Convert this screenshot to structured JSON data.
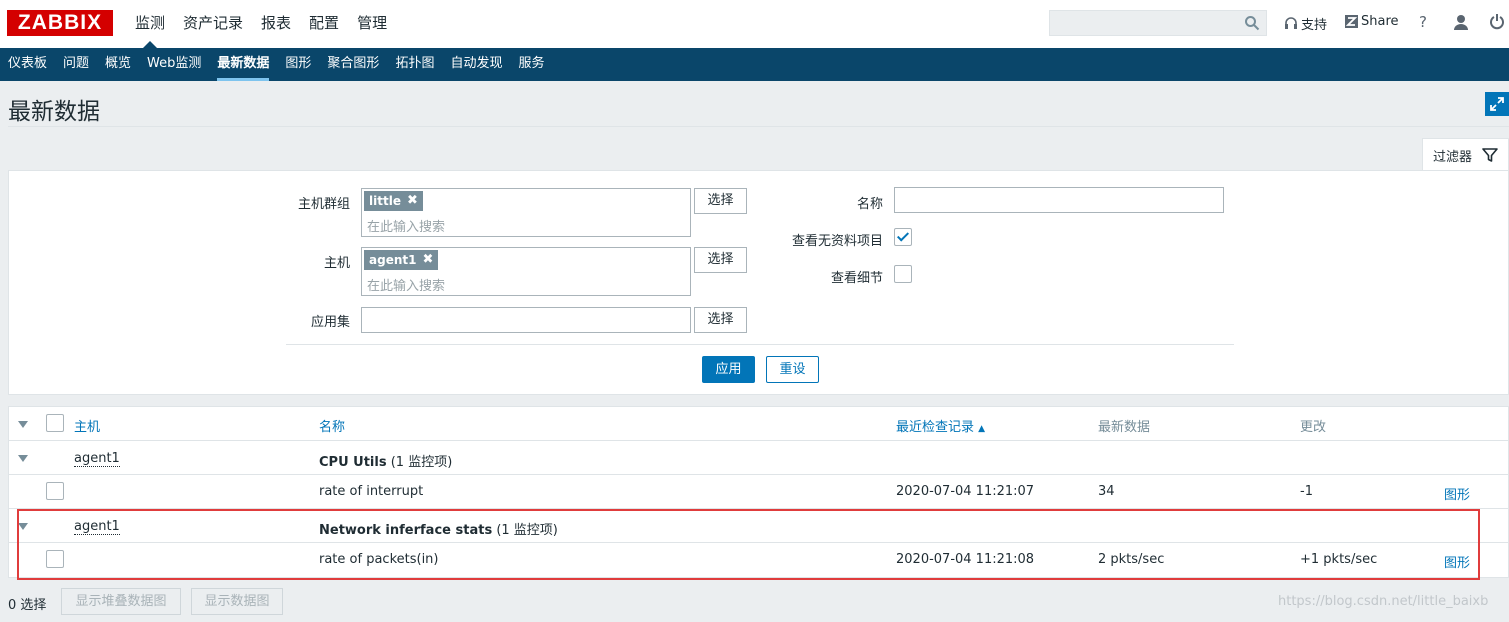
{
  "header": {
    "logo": "ZABBIX",
    "nav": [
      "监测",
      "资产记录",
      "报表",
      "配置",
      "管理"
    ],
    "support": "支持",
    "share": "Share",
    "help": "?"
  },
  "subnav": [
    "仪表板",
    "问题",
    "概览",
    "Web监测",
    "最新数据",
    "图形",
    "聚合图形",
    "拓扑图",
    "自动发现",
    "服务"
  ],
  "page_title": "最新数据",
  "filter": {
    "tab_label": "过滤器",
    "hostgroup_label": "主机群组",
    "hostgroup_chip": "little",
    "hostgroup_placeholder": "在此输入搜索",
    "host_label": "主机",
    "host_chip": "agent1",
    "host_placeholder": "在此输入搜索",
    "application_label": "应用集",
    "select_label": "选择",
    "name_label": "名称",
    "show_without_data_label": "查看无资料项目",
    "show_without_data_checked": true,
    "show_details_label": "查看细节",
    "show_details_checked": false,
    "apply": "应用",
    "reset": "重设"
  },
  "table": {
    "headers": {
      "host": "主机",
      "name": "名称",
      "last_check": "最近检查记录",
      "last_value": "最新数据",
      "change": "更改"
    },
    "groups": [
      {
        "host": "agent1",
        "app": "CPU Utils",
        "count": "(1 监控项)",
        "items": [
          {
            "name": "rate of interrupt",
            "last_check": "2020-07-04 11:21:07",
            "last_value": "34",
            "change": "-1",
            "link": "图形"
          }
        ]
      },
      {
        "host": "agent1",
        "app": "Network inferface stats",
        "count": "(1 监控项)",
        "items": [
          {
            "name": "rate of packets(in)",
            "last_check": "2020-07-04 11:21:08",
            "last_value": "2 pkts/sec",
            "change": "+1 pkts/sec",
            "link": "图形"
          }
        ]
      }
    ]
  },
  "footer": {
    "selected": "0 选择",
    "btn_stacked": "显示堆叠数据图",
    "btn_graph": "显示数据图"
  },
  "watermark": "https://blog.csdn.net/little_baixb"
}
